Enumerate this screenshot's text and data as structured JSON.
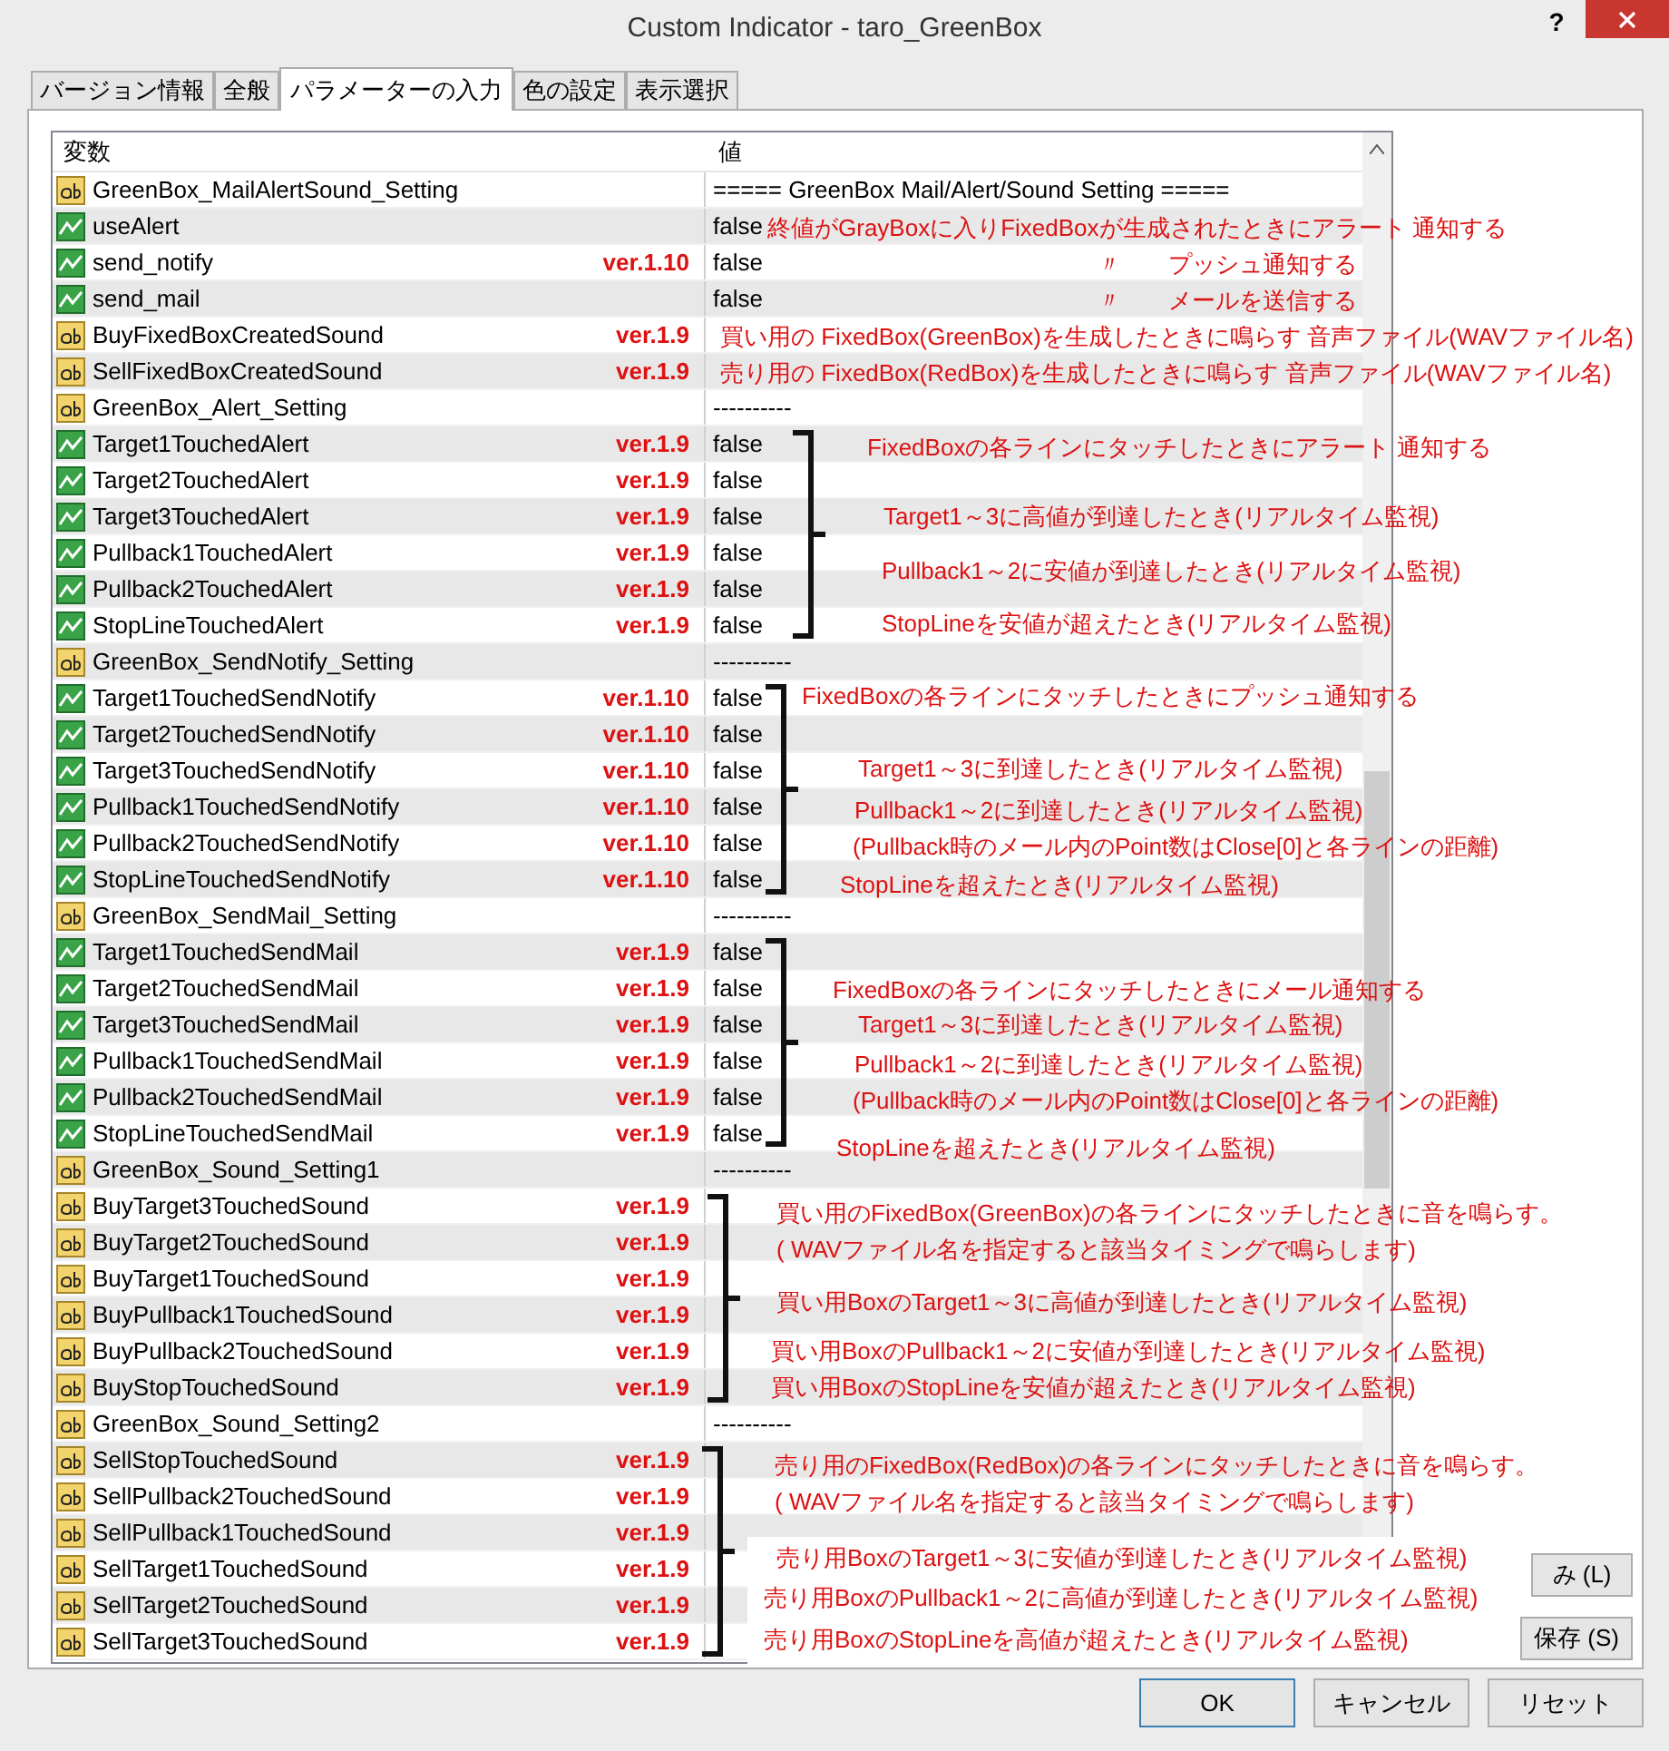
{
  "window": {
    "title": "Custom Indicator - taro_GreenBox",
    "help": "?"
  },
  "tabs": [
    {
      "label": "バージョン情報",
      "selected": false
    },
    {
      "label": "全般",
      "selected": false
    },
    {
      "label": "パラメーターの入力",
      "selected": true
    },
    {
      "label": "色の設定",
      "selected": false
    },
    {
      "label": "表示選択",
      "selected": false
    }
  ],
  "table": {
    "columns": [
      "変数",
      "値"
    ],
    "rows": [
      {
        "kind": "text",
        "name": "GreenBox_MailAlertSound_Setting",
        "value": "===== GreenBox Mail/Alert/Sound Setting ====="
      },
      {
        "kind": "bool",
        "name": "useAlert",
        "value": "false"
      },
      {
        "kind": "bool",
        "name": "send_notify",
        "version": "ver.1.10",
        "value": "false"
      },
      {
        "kind": "bool",
        "name": "send_mail",
        "value": "false"
      },
      {
        "kind": "text",
        "name": "BuyFixedBoxCreatedSound",
        "version": "ver.1.9"
      },
      {
        "kind": "text",
        "name": "SellFixedBoxCreatedSound",
        "version": "ver.1.9"
      },
      {
        "kind": "text",
        "name": "GreenBox_Alert_Setting",
        "value": "----------"
      },
      {
        "kind": "bool",
        "name": "Target1TouchedAlert",
        "version": "ver.1.9",
        "value": "false"
      },
      {
        "kind": "bool",
        "name": "Target2TouchedAlert",
        "version": "ver.1.9",
        "value": "false"
      },
      {
        "kind": "bool",
        "name": "Target3TouchedAlert",
        "version": "ver.1.9",
        "value": "false"
      },
      {
        "kind": "bool",
        "name": "Pullback1TouchedAlert",
        "version": "ver.1.9",
        "value": "false"
      },
      {
        "kind": "bool",
        "name": "Pullback2TouchedAlert",
        "version": "ver.1.9",
        "value": "false"
      },
      {
        "kind": "bool",
        "name": "StopLineTouchedAlert",
        "version": "ver.1.9",
        "value": "false"
      },
      {
        "kind": "text",
        "name": "GreenBox_SendNotify_Setting",
        "value": "----------"
      },
      {
        "kind": "bool",
        "name": "Target1TouchedSendNotify",
        "version": "ver.1.10",
        "value": "false"
      },
      {
        "kind": "bool",
        "name": "Target2TouchedSendNotify",
        "version": "ver.1.10",
        "value": "false"
      },
      {
        "kind": "bool",
        "name": "Target3TouchedSendNotify",
        "version": "ver.1.10",
        "value": "false"
      },
      {
        "kind": "bool",
        "name": "Pullback1TouchedSendNotify",
        "version": "ver.1.10",
        "value": "false"
      },
      {
        "kind": "bool",
        "name": "Pullback2TouchedSendNotify",
        "version": "ver.1.10",
        "value": "false"
      },
      {
        "kind": "bool",
        "name": "StopLineTouchedSendNotify",
        "version": "ver.1.10",
        "value": "false"
      },
      {
        "kind": "text",
        "name": "GreenBox_SendMail_Setting",
        "value": "----------"
      },
      {
        "kind": "bool",
        "name": "Target1TouchedSendMail",
        "version": "ver.1.9",
        "value": "false"
      },
      {
        "kind": "bool",
        "name": "Target2TouchedSendMail",
        "version": "ver.1.9",
        "value": "false"
      },
      {
        "kind": "bool",
        "name": "Target3TouchedSendMail",
        "version": "ver.1.9",
        "value": "false"
      },
      {
        "kind": "bool",
        "name": "Pullback1TouchedSendMail",
        "version": "ver.1.9",
        "value": "false"
      },
      {
        "kind": "bool",
        "name": "Pullback2TouchedSendMail",
        "version": "ver.1.9",
        "value": "false"
      },
      {
        "kind": "bool",
        "name": "StopLineTouchedSendMail",
        "version": "ver.1.9",
        "value": "false"
      },
      {
        "kind": "text",
        "name": "GreenBox_Sound_Setting1",
        "value": "----------"
      },
      {
        "kind": "text",
        "name": "BuyTarget3TouchedSound",
        "version": "ver.1.9"
      },
      {
        "kind": "text",
        "name": "BuyTarget2TouchedSound",
        "version": "ver.1.9"
      },
      {
        "kind": "text",
        "name": "BuyTarget1TouchedSound",
        "version": "ver.1.9"
      },
      {
        "kind": "text",
        "name": "BuyPullback1TouchedSound",
        "version": "ver.1.9"
      },
      {
        "kind": "text",
        "name": "BuyPullback2TouchedSound",
        "version": "ver.1.9"
      },
      {
        "kind": "text",
        "name": "BuyStopTouchedSound",
        "version": "ver.1.9"
      },
      {
        "kind": "text",
        "name": "GreenBox_Sound_Setting2",
        "value": "----------"
      },
      {
        "kind": "text",
        "name": "SellStopTouchedSound",
        "version": "ver.1.9"
      },
      {
        "kind": "text",
        "name": "SellPullback2TouchedSound",
        "version": "ver.1.9"
      },
      {
        "kind": "text",
        "name": "SellPullback1TouchedSound",
        "version": "ver.1.9"
      },
      {
        "kind": "text",
        "name": "SellTarget1TouchedSound",
        "version": "ver.1.9"
      },
      {
        "kind": "text",
        "name": "SellTarget2TouchedSound",
        "version": "ver.1.9"
      },
      {
        "kind": "text",
        "name": "SellTarget3TouchedSound",
        "version": "ver.1.9"
      }
    ]
  },
  "annotations": [
    "終値がGrayBoxに入りFixedBoxが生成されたときにアラート 通知する",
    "〃　　プッシュ通知する",
    "〃　　メールを送信する",
    "買い用の FixedBox(GreenBox)を生成したときに鳴らす 音声ファイル(WAVファイル名)",
    "売り用の FixedBox(RedBox)を生成したときに鳴らす 音声ファイル(WAVファイル名)",
    "FixedBoxの各ラインにタッチしたときにアラート 通知する",
    "Target1～3に高値が到達したとき(リアルタイム監視)",
    "Pullback1～2に安値が到達したとき(リアルタイム監視)",
    "StopLineを安値が超えたとき(リアルタイム監視)",
    "FixedBoxの各ラインにタッチしたときにプッシュ通知する",
    "Target1～3に到達したとき(リアルタイム監視)",
    "Pullback1～2に到達したとき(リアルタイム監視)",
    "(Pullback時のメール内のPoint数はClose[0]と各ラインの距離)",
    "StopLineを超えたとき(リアルタイム監視)",
    "FixedBoxの各ラインにタッチしたときにメール通知する",
    "Target1～3に到達したとき(リアルタイム監視)",
    "Pullback1～2に到達したとき(リアルタイム監視)",
    "(Pullback時のメール内のPoint数はClose[0]と各ラインの距離)",
    "StopLineを超えたとき(リアルタイム監視)",
    "買い用のFixedBox(GreenBox)の各ラインにタッチしたときに音を鳴らす。",
    "( WAVファイル名を指定すると該当タイミングで鳴らします)",
    "買い用BoxのTarget1～3に高値が到達したとき(リアルタイム監視)",
    "買い用BoxのPullback1～2に安値が到達したとき(リアルタイム監視)",
    "買い用BoxのStopLineを安値が超えたとき(リアルタイム監視)",
    "売り用のFixedBox(RedBox)の各ラインにタッチしたときに音を鳴らす。",
    "( WAVファイル名を指定すると該当タイミングで鳴らします)",
    "売り用BoxのTarget1～3に安値が到達したとき(リアルタイム監視)",
    "売り用BoxのPullback1～2に高値が到達したとき(リアルタイム監視)",
    "売り用BoxのStopLineを高値が超えたとき(リアルタイム監視)"
  ],
  "side_buttons": [
    "み (L)",
    "保存 (S)"
  ],
  "buttons": [
    "OK",
    "キャンセル",
    "リセット"
  ]
}
